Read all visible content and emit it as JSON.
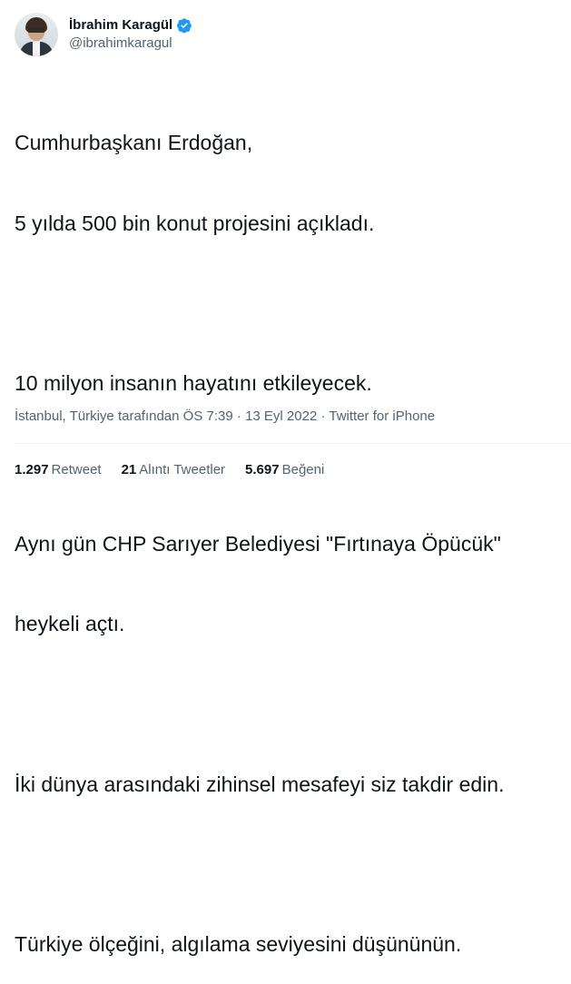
{
  "author": {
    "display_name": "İbrahim Karagül",
    "handle": "@ibrahimkaragul",
    "verified_badge_color": "#1d9bf0"
  },
  "tweet": {
    "lines": [
      "Cumhurbaşkanı Erdoğan,",
      "5 yılda 500 bin konut projesini açıkladı.",
      "",
      "10 milyon insanın hayatını etkileyecek.",
      "",
      "Aynı gün CHP Sarıyer Belediyesi \"Fırtınaya Öpücük\"",
      "heykeli açtı.",
      "",
      "İki dünya arasındaki zihinsel mesafeyi siz takdir edin.",
      "",
      "Türkiye ölçeğini, algılama seviyesini düşününün."
    ]
  },
  "meta": {
    "location": "İstanbul, Türkiye tarafından",
    "time": "ÖS 7:39",
    "separator": "·",
    "date": "13 Eyl 2022",
    "source": "Twitter for iPhone"
  },
  "stats": {
    "retweets_count": "1.297",
    "retweets_label": "Retweet",
    "quotes_count": "21",
    "quotes_label": "Alıntı Tweetler",
    "likes_count": "5.697",
    "likes_label": "Beğeni"
  },
  "icons": {
    "verified": "verified-badge-icon"
  }
}
